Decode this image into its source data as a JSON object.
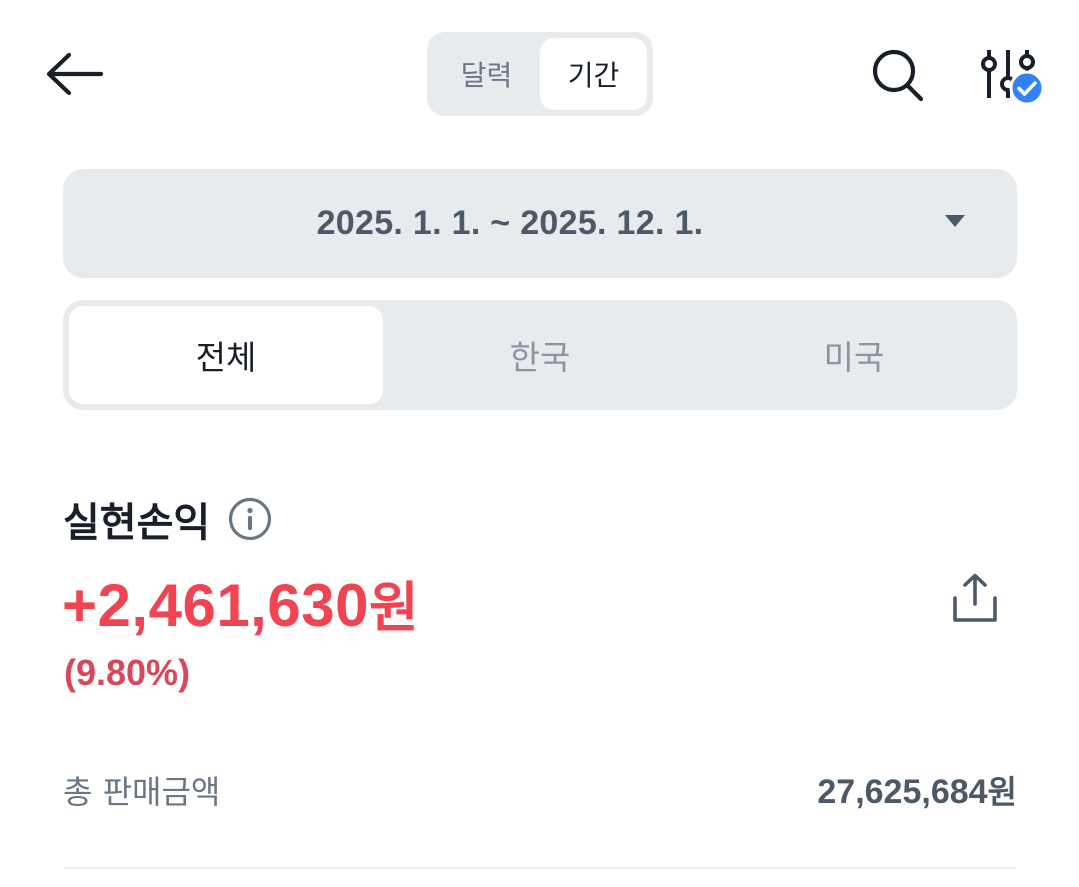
{
  "header": {
    "view_toggle": {
      "options": [
        "달력",
        "기간"
      ],
      "selected": "기간"
    },
    "icons": {
      "back": "arrow-left-icon",
      "search": "search-icon",
      "filter": "sliders-icon",
      "filter_badge": "check-badge-icon"
    },
    "filter_badge_color": "#3182f6"
  },
  "date_range": {
    "text": "2025. 1. 1. ~ 2025. 12. 1."
  },
  "market_tabs": {
    "items": [
      "전체",
      "한국",
      "미국"
    ],
    "selected": "전체"
  },
  "realized_pnl": {
    "title": "실현손익",
    "amount": "+2,461,630",
    "unit": "원",
    "rate": "(9.80%)",
    "color": "#f04452"
  },
  "summary_rows": [
    {
      "label": "총 판매금액",
      "value": "27,625,684",
      "unit": "원"
    }
  ]
}
